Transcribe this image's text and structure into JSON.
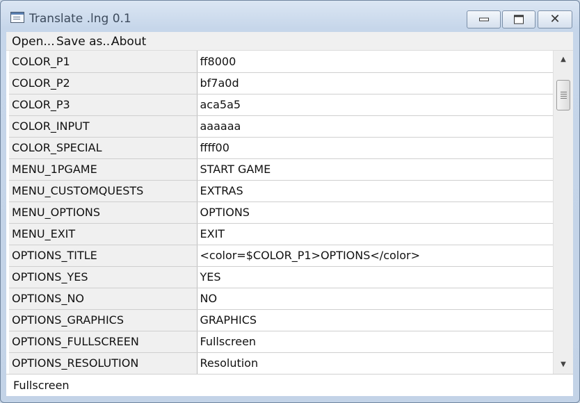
{
  "window": {
    "title": "Translate .lng 0.1",
    "close_symbol": "✕"
  },
  "menu": [
    {
      "label": "Open..."
    },
    {
      "label": "Save as..."
    },
    {
      "label": "About"
    }
  ],
  "table": {
    "rows": [
      {
        "key": "COLOR_P1",
        "value": "ff8000"
      },
      {
        "key": "COLOR_P2",
        "value": "bf7a0d"
      },
      {
        "key": "COLOR_P3",
        "value": "aca5a5"
      },
      {
        "key": "COLOR_INPUT",
        "value": "aaaaaa"
      },
      {
        "key": "COLOR_SPECIAL",
        "value": "ffff00"
      },
      {
        "key": "MENU_1PGAME",
        "value": "START GAME"
      },
      {
        "key": "MENU_CUSTOMQUESTS",
        "value": "EXTRAS"
      },
      {
        "key": "MENU_OPTIONS",
        "value": "OPTIONS"
      },
      {
        "key": "MENU_EXIT",
        "value": "EXIT"
      },
      {
        "key": "OPTIONS_TITLE",
        "value": "<color=$COLOR_P1>OPTIONS</color>"
      },
      {
        "key": "OPTIONS_YES",
        "value": "YES"
      },
      {
        "key": "OPTIONS_NO",
        "value": "NO"
      },
      {
        "key": "OPTIONS_GRAPHICS",
        "value": "GRAPHICS"
      },
      {
        "key": "OPTIONS_FULLSCREEN",
        "value": "Fullscreen"
      },
      {
        "key": "OPTIONS_RESOLUTION",
        "value": "Resolution"
      }
    ]
  },
  "status": {
    "text": "Fullscreen"
  },
  "scrollbar": {
    "up_symbol": "▲",
    "down_symbol": "▼"
  }
}
